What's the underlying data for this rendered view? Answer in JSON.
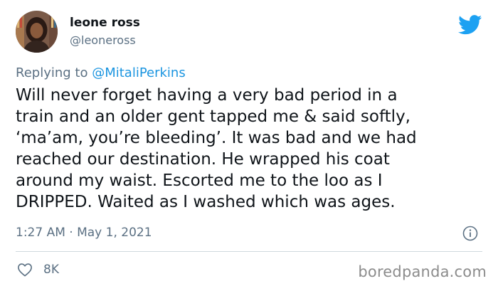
{
  "author": {
    "display_name": "leone ross",
    "handle": "@leoneross"
  },
  "reply": {
    "prefix": "Replying to ",
    "mention": "@MitaliPerkins"
  },
  "tweet": {
    "text": "Will never forget having a very bad period in a\ntrain and an older gent tapped me & said softly,\n‘ma’am, you’re bleeding’. It was bad and we had\nreached our destination. He wrapped his coat\naround my waist. Escorted me to the loo as I\nDRIPPED. Waited as I washed which was ages.",
    "timestamp": "1:27 AM · May 1, 2021"
  },
  "stats": {
    "likes": "8K"
  },
  "watermark": "boredpanda.com",
  "icons": {
    "brand": "twitter-bird-icon",
    "info": "info-icon",
    "like": "heart-icon"
  },
  "colors": {
    "twitter_blue": "#1da1f2",
    "mention_blue": "#1b95e0",
    "secondary_text": "#5b7083",
    "primary_text": "#0f1419"
  }
}
